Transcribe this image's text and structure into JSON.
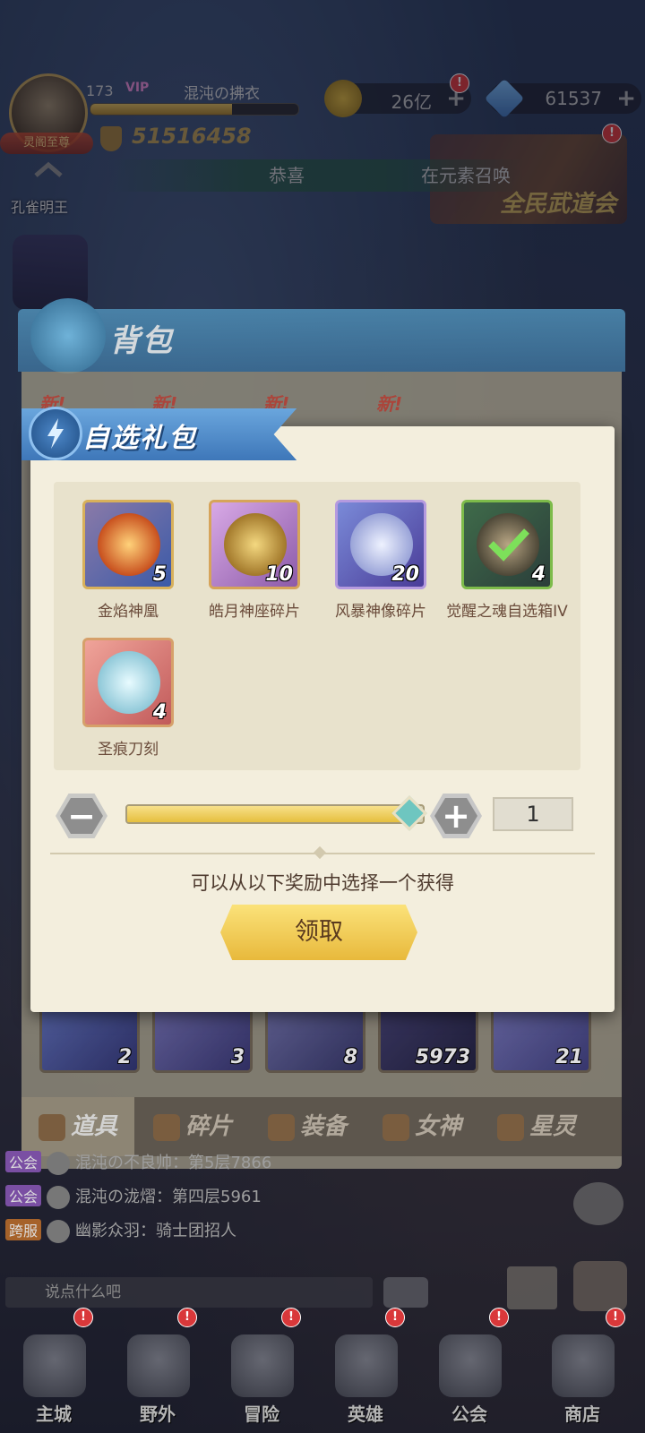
{
  "hud": {
    "level": "173",
    "vip": "VIP",
    "player_name": "混沌の拂衣",
    "exp_fraction": 0.68,
    "power": "51516458",
    "avatar_badge": "灵阁至尊",
    "gold": "26亿",
    "gems": "61537",
    "plus": "+",
    "hint_left": "恭喜",
    "hint_right": "在元素召唤",
    "event_banner": "全民武道会",
    "hero_label": "孔雀明王",
    "red_mark": "!"
  },
  "bag": {
    "title": "背包",
    "new_tag": "新!",
    "visible_counts": [
      "2",
      "3",
      "8",
      "5973",
      "21"
    ],
    "tabs": [
      {
        "label": "道具",
        "active": true
      },
      {
        "label": "碎片",
        "active": false
      },
      {
        "label": "装备",
        "active": false
      },
      {
        "label": "女神",
        "active": false
      },
      {
        "label": "星灵",
        "active": false
      }
    ]
  },
  "dialog": {
    "title": "自选礼包",
    "rewards": [
      {
        "name": "金焰神凰",
        "count": "5",
        "quality": "gold"
      },
      {
        "name": "皓月神座碎片",
        "count": "10",
        "quality": "orange"
      },
      {
        "name": "风暴神像碎片",
        "count": "20",
        "quality": "purple"
      },
      {
        "name": "觉醒之魂自选箱IV",
        "count": "4",
        "quality": "green"
      },
      {
        "name": "圣痕刀刻",
        "count": "4",
        "quality": "red"
      }
    ],
    "quantity": "1",
    "slider_fraction": 0.95,
    "minus": "−",
    "plus": "+",
    "instruction": "可以从以下奖励中选择一个获得",
    "claim_label": "领取"
  },
  "chat": {
    "lines": [
      {
        "channel": "公会",
        "text": "混沌の不良帅：第5层7866"
      },
      {
        "channel": "公会",
        "text": "混沌の泷熠：第四层5961"
      },
      {
        "channel": "跨服",
        "text": "幽影众羽：骑士团招人"
      }
    ],
    "input_placeholder": "说点什么吧"
  },
  "nav": {
    "items": [
      "主城",
      "野外",
      "冒险",
      "英雄",
      "公会",
      "商店"
    ]
  },
  "colors": {
    "dialog_bg": "#f3eedd",
    "ribbon": "#3e77b9",
    "claim_button": "#e8b93c",
    "slider_fill": "#e6bf3e"
  }
}
